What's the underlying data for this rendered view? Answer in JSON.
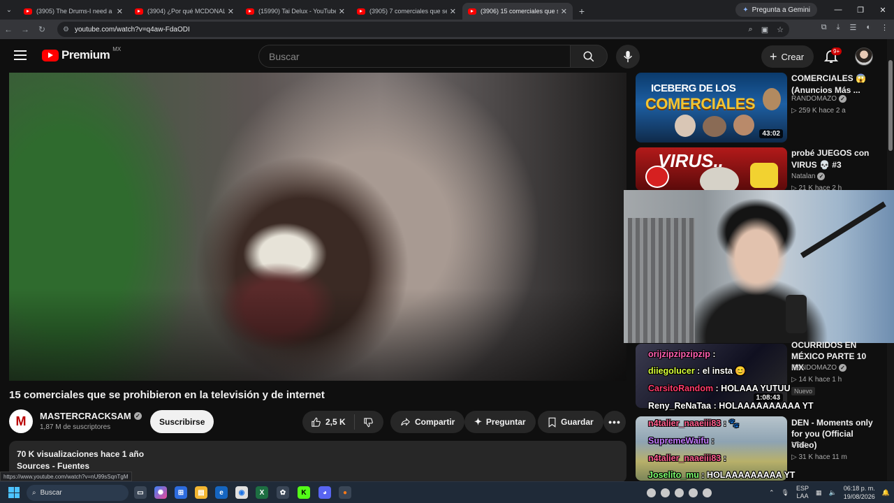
{
  "browser": {
    "tabs": [
      {
        "title": "(3905) The Drums-I need a Do...",
        "active": false
      },
      {
        "title": "(3904) ¿Por qué MCDONALD'S...",
        "active": false
      },
      {
        "title": "(15990) Tai Delux - YouTube",
        "active": false
      },
      {
        "title": "(3905) 7 comerciales que se pro...",
        "active": false
      },
      {
        "title": "(3906) 15 comerciales que se p...",
        "active": true
      }
    ],
    "gemini_label": "Pregunta a Gemini",
    "url": "youtube.com/watch?v=q4aw-FdaODI",
    "status_url": "https://www.youtube.com/watch?v=nU99sSqnTgM"
  },
  "header": {
    "logo_text": "Premium",
    "country_code": "MX",
    "search_placeholder": "Buscar",
    "create_label": "Crear",
    "notif_badge": "9+"
  },
  "video": {
    "title": "15 comerciales que se prohibieron en la televisión y de internet",
    "channel": "MASTERCRACKSAM",
    "subscribers": "1,87 M de suscriptores",
    "subscribe_label": "Suscribirse",
    "likes": "2,5 K",
    "share_label": "Compartir",
    "ask_label": "Preguntar",
    "save_label": "Guardar",
    "views_date": "70 K visualizaciones  hace 1 año",
    "desc_line": "Sources - Fuentes"
  },
  "recommendations": [
    {
      "title": "COMERCIALES 😱 (Anuncios Más ...",
      "channel": "RANDOMAZO",
      "meta": "▷ 259 K  hace 2 a",
      "duration": "43:02",
      "thumb_text1": "ICEBERG DE LOS",
      "thumb_text2": "COMERCIALES"
    },
    {
      "title": "probé JUEGOS con VIRUS 💀 #3",
      "channel": "Natalan",
      "meta": "▷ 21 K  hace 2 h",
      "thumb_text1": "VIRUS.."
    },
    {
      "title": "OCURRIDOS EN MÉXICO PARTE 10 MX",
      "channel": "RANDOMAZO",
      "meta": "▷ 14 K  hace 1 h",
      "duration": "1:08:43",
      "badge": "Nuevo"
    },
    {
      "title": "DEN - Moments only for you (Official Video)",
      "channel": "DEN",
      "meta": "▷ 31 K  hace 11 m"
    }
  ],
  "chat": [
    {
      "nick": "orijzipzipzipzip",
      "text": " :",
      "color": "#ff5fb0"
    },
    {
      "nick": "diiegolucer",
      "text": " : el insta 😊",
      "color": "#d8ff3a"
    },
    {
      "nick": "CarsitoRandom",
      "text": " : HOLAAA YUTUU",
      "color": "#ff3b6b"
    },
    {
      "nick": "Reny_ReNaTaa",
      "text": " : HOLAAAAAAAAAA YT",
      "color": "#ffffff"
    },
    {
      "nick": "n4talier_naaeiii83",
      "text": " : 🐾",
      "color": "#ff5f8f"
    },
    {
      "nick": "SupremeWaifu",
      "text": " :",
      "color": "#c27bff"
    },
    {
      "nick": "n4talier_naaeiii83",
      "text": " :",
      "color": "#ff5f8f"
    },
    {
      "nick": "Joselito_mu",
      "text": " : HOLAAAAAAAAA YT",
      "color": "#7dff6e"
    }
  ],
  "taskbar": {
    "search_label": "Buscar",
    "lang_1": "ESP",
    "lang_2": "LAA",
    "time": "06:18 p. m.",
    "date": "19/08/2026"
  },
  "colors": {
    "accent": "#ff0000",
    "background": "#0f0f0f",
    "chip": "#272727"
  }
}
